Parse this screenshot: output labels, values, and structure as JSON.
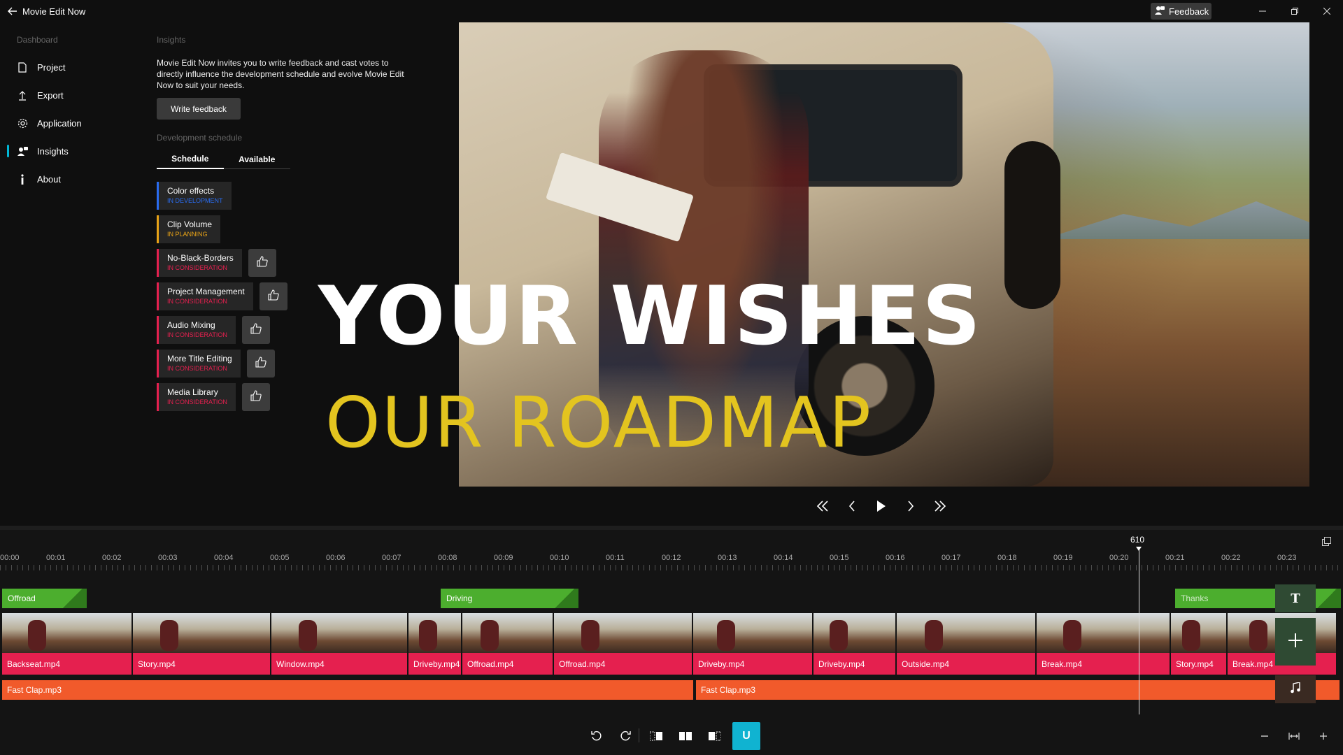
{
  "app": {
    "title": "Movie Edit Now",
    "feedback_label": "Feedback"
  },
  "sidebar": {
    "heading": "Dashboard",
    "items": [
      {
        "label": "Project",
        "icon": "file-icon"
      },
      {
        "label": "Export",
        "icon": "upload-icon"
      },
      {
        "label": "Application",
        "icon": "gear-icon"
      },
      {
        "label": "Insights",
        "icon": "insights-icon",
        "active": true
      },
      {
        "label": "About",
        "icon": "info-icon"
      }
    ]
  },
  "insights": {
    "heading": "Insights",
    "description": "Movie Edit Now invites you to write feedback and cast votes to directly influence the development schedule and evolve Movie Edit Now to suit your needs.",
    "write_feedback_label": "Write feedback",
    "dev_schedule_heading": "Development schedule",
    "tabs": [
      {
        "label": "Schedule",
        "active": true
      },
      {
        "label": "Available"
      }
    ],
    "features": [
      {
        "name": "Color effects",
        "status": "IN DEVELOPMENT",
        "color": "#2a6cf0",
        "votable": false
      },
      {
        "name": "Clip Volume",
        "status": "IN PLANNING",
        "color": "#e8a317",
        "votable": false
      },
      {
        "name": "No-Black-Borders",
        "status": "IN CONSIDERATION",
        "color": "#e5204f",
        "votable": true
      },
      {
        "name": "Project Management",
        "status": "IN CONSIDERATION",
        "color": "#e5204f",
        "votable": true
      },
      {
        "name": "Audio Mixing",
        "status": "IN CONSIDERATION",
        "color": "#e5204f",
        "votable": true
      },
      {
        "name": "More Title Editing",
        "status": "IN CONSIDERATION",
        "color": "#e5204f",
        "votable": true
      },
      {
        "name": "Media Library",
        "status": "IN CONSIDERATION",
        "color": "#e5204f",
        "votable": true
      }
    ]
  },
  "preview": {
    "headline": "YOUR WISHES",
    "subheadline": "OUR ROADMAP",
    "headline_color": "#ffffff",
    "subheadline_color": "#e3c41f"
  },
  "timeline": {
    "playhead_label": "610",
    "ruler_labels": [
      "00:00",
      "00:01",
      "00:02",
      "00:03",
      "00:04",
      "00:05",
      "00:06",
      "00:07",
      "00:08",
      "00:09",
      "00:10",
      "00:11",
      "00:12",
      "00:13",
      "00:14",
      "00:15",
      "00:16",
      "00:17",
      "00:18",
      "00:19",
      "00:20",
      "00:21",
      "00:22",
      "00:23"
    ],
    "title_clips": [
      "Offroad",
      "Driving",
      "Thanks"
    ],
    "video_clips": [
      "Backseat.mp4",
      "Story.mp4",
      "Window.mp4",
      "Driveby.mp4",
      "Offroad.mp4",
      "Offroad.mp4",
      "Driveby.mp4",
      "Driveby.mp4",
      "Outside.mp4",
      "Break.mp4",
      "Story.mp4",
      "Break.mp4"
    ],
    "audio_clips": [
      "Fast Clap.mp3",
      "Fast Clap.mp3"
    ],
    "add_title_label": "T",
    "accent_color": "#10b3d1"
  },
  "toolbar": {
    "u_label": "U"
  }
}
